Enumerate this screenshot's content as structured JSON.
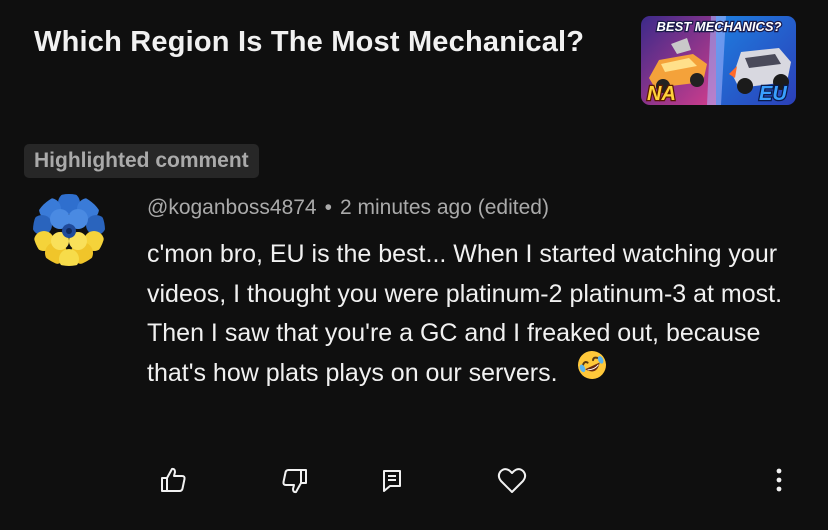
{
  "video": {
    "title": "Which Region Is The Most Mechanical?",
    "thumbnail": {
      "top_text": "BEST MECHANICS?",
      "left_label": "NA",
      "right_label": "EU"
    }
  },
  "badge_label": "Highlighted comment",
  "comment": {
    "author": "@koganboss4874",
    "separator": "•",
    "time": "2 minutes ago (edited)",
    "text": "c'mon bro, EU is the best... When I started watching your videos, I thought you were platinum-2 platinum-3 at most. Then I saw that you're a GC and I freaked out, because that's how plats plays on our servers.",
    "emoji": "rolling-on-floor-laughing"
  },
  "actions": [
    {
      "icon": "thumbs-up-icon"
    },
    {
      "icon": "thumbs-down-icon"
    },
    {
      "icon": "reply-icon"
    },
    {
      "icon": "heart-icon"
    },
    {
      "icon": "more-vertical-icon"
    }
  ],
  "colors": {
    "background": "#0f0f0f",
    "primary_text": "#f1f1f1",
    "secondary_text": "#aaaaaa",
    "badge_bg": "#272727",
    "avatar_blue": "#2f6fce",
    "avatar_yellow": "#f5d33a"
  }
}
